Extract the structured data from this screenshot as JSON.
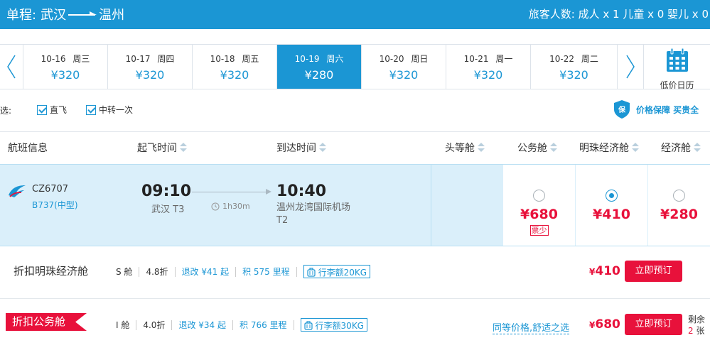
{
  "header": {
    "trip_type": "单程:",
    "origin": "武汉",
    "destination": "温州",
    "passengers": "旅客人数: 成人 x 1 儿童 x 0 婴儿 x 0"
  },
  "dates": [
    {
      "date": "10-16",
      "weekday": "周三",
      "price": "¥320",
      "active": false
    },
    {
      "date": "10-17",
      "weekday": "周四",
      "price": "¥320",
      "active": false
    },
    {
      "date": "10-18",
      "weekday": "周五",
      "price": "¥320",
      "active": false
    },
    {
      "date": "10-19",
      "weekday": "周六",
      "price": "¥280",
      "active": true
    },
    {
      "date": "10-20",
      "weekday": "周日",
      "price": "¥320",
      "active": false
    },
    {
      "date": "10-21",
      "weekday": "周一",
      "price": "¥320",
      "active": false
    },
    {
      "date": "10-22",
      "weekday": "周二",
      "price": "¥320",
      "active": false
    }
  ],
  "calendar_label": "低价日历",
  "filters": {
    "label": "选:",
    "direct": "直飞",
    "transfer": "中转一次",
    "guarantee": "价格保障 买贵全"
  },
  "columns": {
    "flight_info": "航班信息",
    "depart": "起飞时间",
    "arrive": "到达时间",
    "first": "头等舱",
    "business": "公务舱",
    "pearl": "明珠经济舱",
    "economy": "经济舱"
  },
  "flight": {
    "number": "CZ6707",
    "aircraft": "B737(中型)",
    "dep_time": "09:10",
    "dep_airport": "武汉 T3",
    "duration": "1h30m",
    "arr_time": "10:40",
    "arr_airport": "温州龙湾国际机场",
    "arr_terminal": "T2",
    "fares": {
      "business": "¥680",
      "business_note": "票少",
      "pearl": "¥410",
      "economy": "¥280"
    }
  },
  "cabin_rows": [
    {
      "name": "折扣明珠经济舱",
      "cls": "S 舱",
      "discount": "4.8折",
      "change": "退改 ¥41 起",
      "miles": "积 575 里程",
      "luggage": "行李额20KG",
      "price_symbol": "¥",
      "price": "410",
      "button": "立即预订"
    },
    {
      "name": "折扣公务舱",
      "cls": "I 舱",
      "discount": "4.0折",
      "change": "退改 ¥34 起",
      "miles": "积 766 里程",
      "luggage": "行李额30KG",
      "same_price": "同等价格,舒适之选",
      "price_symbol": "¥",
      "price": "680",
      "button": "立即预订",
      "remain_label": "剩余",
      "remain_count": "2",
      "remain_unit": "张"
    }
  ],
  "colors": {
    "brand_blue": "#1b96d4",
    "price_red": "#e8113b",
    "row_highlight": "#daeffa"
  }
}
